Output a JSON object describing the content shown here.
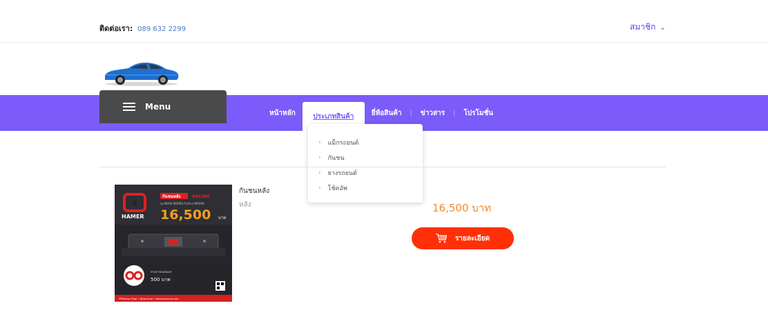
{
  "header": {
    "contact_label": "ติดต่อเรา:",
    "phone": "089 632 2299",
    "member_label": "สมาชิก"
  },
  "nav": {
    "menu_label": "Menu",
    "items": [
      {
        "label": "หน้าหลัก"
      },
      {
        "label": "ประเภทสินค้า"
      },
      {
        "label": "ยี่ห้อสินค้า"
      },
      {
        "label": "ข่าวสาร"
      },
      {
        "label": "โปรโมชั่น"
      }
    ],
    "dropdown": [
      {
        "label": "แม็กรถยนต์"
      },
      {
        "label": "กันชน"
      },
      {
        "label": "ยางรถยนต์"
      },
      {
        "label": "โช้คอัพ"
      }
    ]
  },
  "product": {
    "name": "กันชนหลัง",
    "category": "หลัง",
    "price": "16,500 บาท",
    "detail_label": "รายละเอียด",
    "image": {
      "tag": "กันชนหลัง",
      "badge": "RACING",
      "model": "รุ่น NOVA SERIES (ใบข้าง) MX204",
      "brand": "HAMER",
      "price": "16,500",
      "price_unit": "บาท",
      "hook_label": "ห่วงลากสแตนเลส",
      "hook_price": "500 บาท",
      "footer": "ZPRacing Shop  •  @zpracing  •  www.zpracing.com"
    }
  },
  "colors": {
    "nav_bg": "#7b5cfa",
    "menu_bg": "#4a4a4a",
    "price": "#f08a2a",
    "button": "#ff3008"
  }
}
